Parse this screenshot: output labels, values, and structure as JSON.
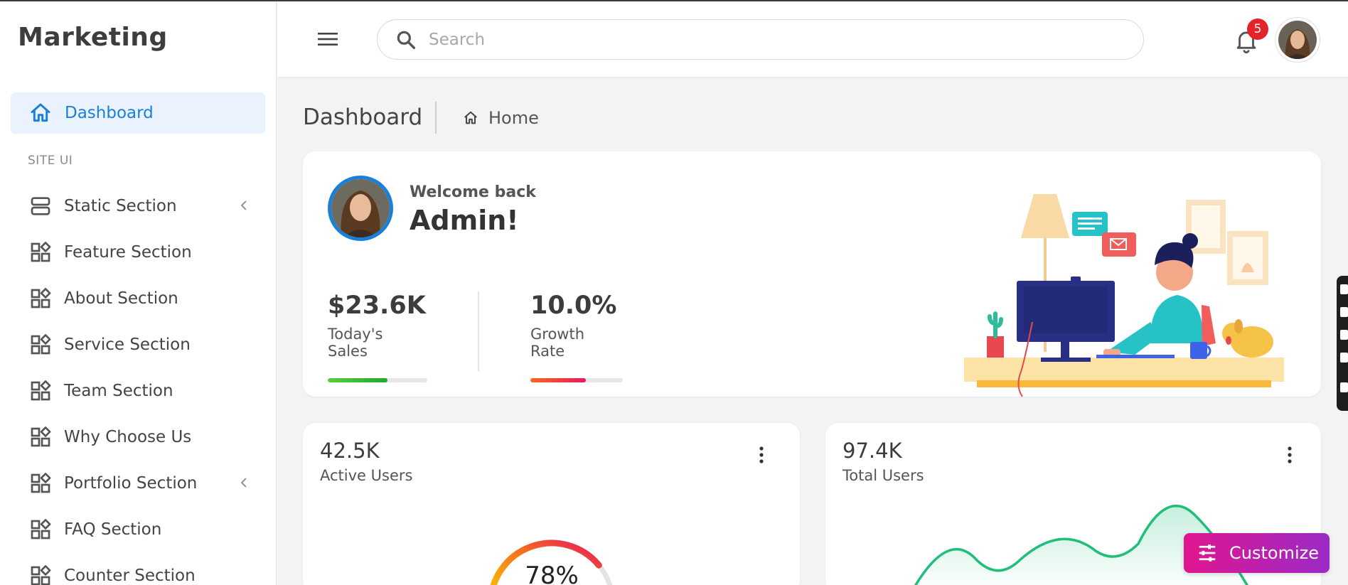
{
  "app": {
    "brand": "Marketing"
  },
  "sidebar": {
    "active": {
      "label": "Dashboard",
      "icon": "home-icon"
    },
    "section_title": "SITE UI",
    "items": [
      {
        "label": "Static Section",
        "icon": "server-icon",
        "has_submenu": true
      },
      {
        "label": "Feature Section",
        "icon": "widgets-icon",
        "has_submenu": false
      },
      {
        "label": "About Section",
        "icon": "widgets-icon",
        "has_submenu": false
      },
      {
        "label": "Service Section",
        "icon": "widgets-icon",
        "has_submenu": false
      },
      {
        "label": "Team Section",
        "icon": "widgets-icon",
        "has_submenu": false
      },
      {
        "label": "Why Choose Us",
        "icon": "widgets-icon",
        "has_submenu": false
      },
      {
        "label": "Portfolio Section",
        "icon": "widgets-icon",
        "has_submenu": true
      },
      {
        "label": "FAQ Section",
        "icon": "widgets-icon",
        "has_submenu": false
      },
      {
        "label": "Counter Section",
        "icon": "widgets-icon",
        "has_submenu": false
      }
    ]
  },
  "header": {
    "search_placeholder": "Search",
    "notification_count": "5"
  },
  "page": {
    "title": "Dashboard",
    "breadcrumb": "Home"
  },
  "welcome": {
    "subtitle": "Welcome back",
    "name": "Admin!",
    "stats": [
      {
        "value": "$23.6K",
        "label": "Today's Sales",
        "progress": 0.6,
        "colors": [
          "#58cf3d",
          "#20a830"
        ]
      },
      {
        "value": "10.0%",
        "label": "Growth Rate",
        "progress": 0.6,
        "colors": [
          "#f46a1f",
          "#e8185e"
        ]
      }
    ]
  },
  "cards": {
    "active_users": {
      "value": "42.5K",
      "label": "Active Users",
      "gauge_percent": 78,
      "gauge_label": "78%"
    },
    "total_users": {
      "value": "97.4K",
      "label": "Total Users"
    }
  },
  "customize": {
    "label": "Customize"
  },
  "colors": {
    "accent": "#1a7fd8",
    "badge": "#e3242b",
    "wave": "#1fbf7a"
  }
}
